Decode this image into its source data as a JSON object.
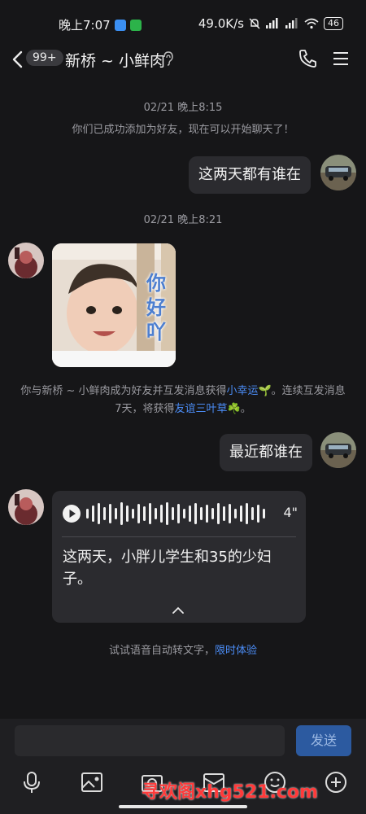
{
  "status_bar": {
    "time": "晚上7:07",
    "network_speed": "49.0K/s",
    "signal1": "HD",
    "signal2": "HD",
    "battery": "46"
  },
  "header": {
    "unread_badge": "99+",
    "title": "新桥 ~ 小鲜肉",
    "icons": [
      "back-icon",
      "ear-icon",
      "phone-icon",
      "menu-icon"
    ]
  },
  "chat": {
    "timestamp1": "02/21 晚上8:15",
    "system_added": "你们已成功添加为好友，现在可以开始聊天了！",
    "msg_out_1": "这两天都有谁在",
    "timestamp2": "02/21 晚上8:21",
    "sticker_text": "你好吖",
    "system_streak": {
      "part1": "你与新桥 ~ 小鲜肉成为好友并互发消息获得",
      "link1": "小幸运🌱",
      "part2": "。连续互发消息7天，将获得",
      "link2": "友谊三叶草☘️",
      "part3": "。"
    },
    "msg_out_2": "最近都谁在",
    "voice": {
      "duration": "4\"",
      "transcript": "这两天，小胖儿学生和35的少妇子。"
    },
    "try_transcribe": {
      "text": "试试语音自动转文字，",
      "link": "限时体验"
    }
  },
  "input_bar": {
    "placeholder": "",
    "send_label": "发送",
    "tools": [
      "mic-icon",
      "image-icon",
      "camera-icon",
      "folder-icon",
      "emoji-icon",
      "plus-icon"
    ]
  },
  "watermark": "寻欢阁xhg521.com",
  "colors": {
    "background": "#161618",
    "bubble": "#2b2b2f",
    "link": "#4b8cf5",
    "send_button": "#2c5aa0"
  }
}
